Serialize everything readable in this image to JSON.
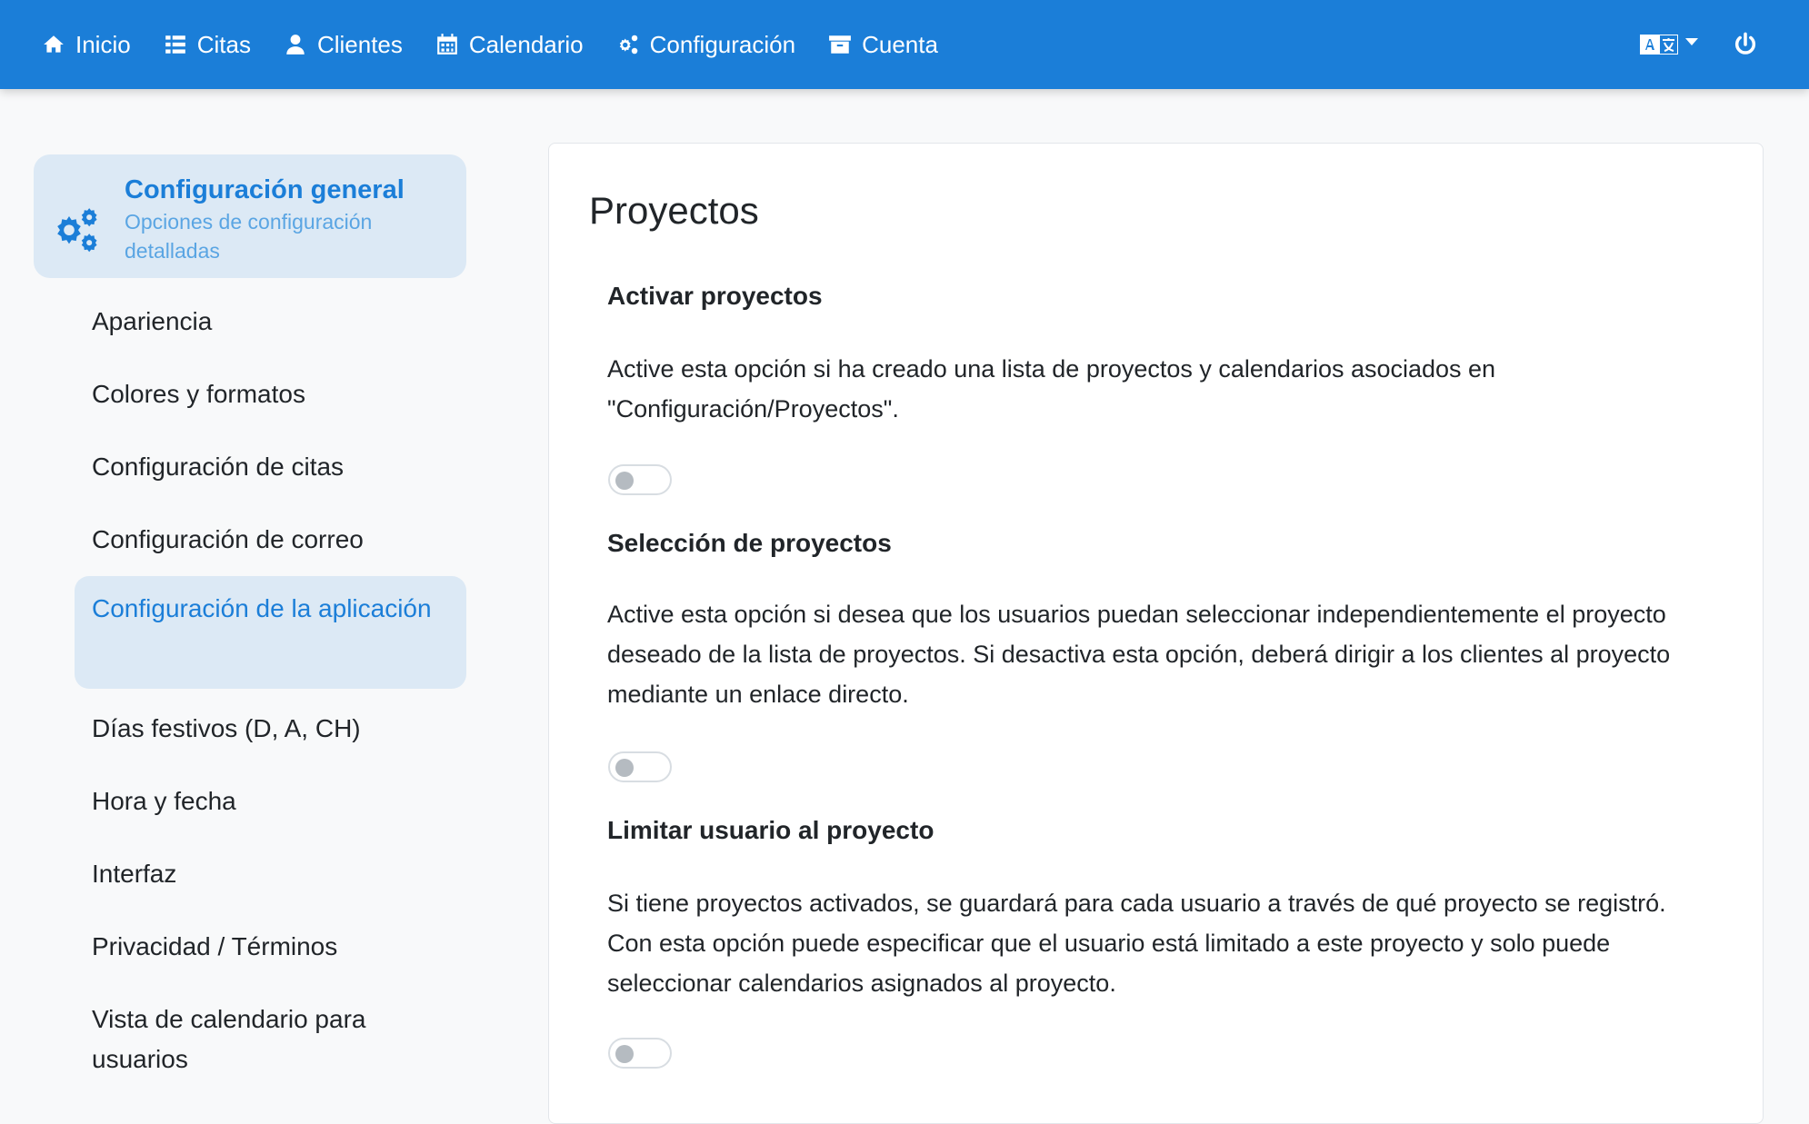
{
  "nav": {
    "items": [
      {
        "label": "Inicio",
        "icon": "home-icon"
      },
      {
        "label": "Citas",
        "icon": "list-icon"
      },
      {
        "label": "Clientes",
        "icon": "user-icon"
      },
      {
        "label": "Calendario",
        "icon": "calendar-icon"
      },
      {
        "label": "Configuración",
        "icon": "gears-icon"
      },
      {
        "label": "Cuenta",
        "icon": "archive-icon"
      }
    ],
    "language_icon": "language-icon",
    "power_icon": "power-icon",
    "accent_color": "#1b7ed8"
  },
  "sidebar": {
    "header": {
      "title": "Configuración general",
      "subtitle": "Opciones de configuración detalladas",
      "icon": "gears-icon"
    },
    "items": [
      {
        "label": "Apariencia",
        "active": false
      },
      {
        "label": "Colores y formatos",
        "active": false
      },
      {
        "label": "Configuración de citas",
        "active": false
      },
      {
        "label": "Configuración de correo",
        "active": false
      },
      {
        "label": "Configuración de la aplicación",
        "active": true
      },
      {
        "label": "Días festivos (D, A, CH)",
        "active": false
      },
      {
        "label": "Hora y fecha",
        "active": false
      },
      {
        "label": "Interfaz",
        "active": false
      },
      {
        "label": "Privacidad / Términos",
        "active": false
      },
      {
        "label": "Vista de calendario para usuarios",
        "active": false
      }
    ]
  },
  "main": {
    "title": "Proyectos",
    "settings": [
      {
        "label": "Activar proyectos",
        "description": "Active esta opción si ha creado una lista de proyectos y calendarios asociados en \"Configuración/Proyectos\".",
        "enabled": false
      },
      {
        "label": "Selección de proyectos",
        "description": "Active esta opción si desea que los usuarios puedan seleccionar independientemente el proyecto deseado de la lista de proyectos. Si desactiva esta opción, deberá dirigir a los clientes al proyecto mediante un enlace directo.",
        "enabled": false
      },
      {
        "label": "Limitar usuario al proyecto",
        "description": "Si tiene proyectos activados, se guardará para cada usuario a través de qué proyecto se registró. Con esta opción puede especificar que el usuario está limitado a este proyecto y solo puede seleccionar calendarios asignados al proyecto.",
        "enabled": false
      }
    ]
  }
}
